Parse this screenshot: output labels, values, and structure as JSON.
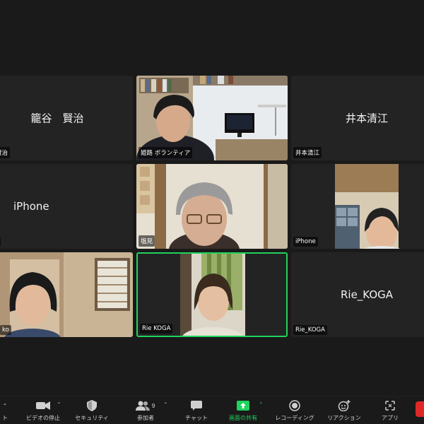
{
  "participants": [
    {
      "center_name": "籠谷　賢治",
      "tag": "谷　賢治"
    },
    {
      "center_name": "",
      "tag": "姫路 ボランティア"
    },
    {
      "center_name": "井本清江",
      "tag": "井本清江"
    },
    {
      "center_name": "iPhone",
      "tag": "hone"
    },
    {
      "center_name": "",
      "tag": "塩見"
    },
    {
      "center_name": "",
      "tag": "iPhone"
    },
    {
      "center_name": "",
      "tag": "ko"
    },
    {
      "center_name": "",
      "tag": "Rie KOGA"
    },
    {
      "center_name": "Rie_KOGA",
      "tag": "Rie_KOGA"
    }
  ],
  "toolbar": {
    "left_partial_label": "ト",
    "video_label": "ビデオの停止",
    "security_label": "セキュリティ",
    "participants_label": "参加者",
    "participants_count": "9",
    "chat_label": "チャット",
    "share_label": "画面の共有",
    "record_label": "レコーディング",
    "reaction_label": "リアクション",
    "apps_label": "アプリ"
  },
  "colors": {
    "background": "#1a1a1a",
    "tile": "#232323",
    "active_speaker_border": "#1fd35c",
    "share_green": "#1fd35c",
    "end_red": "#e02828"
  }
}
